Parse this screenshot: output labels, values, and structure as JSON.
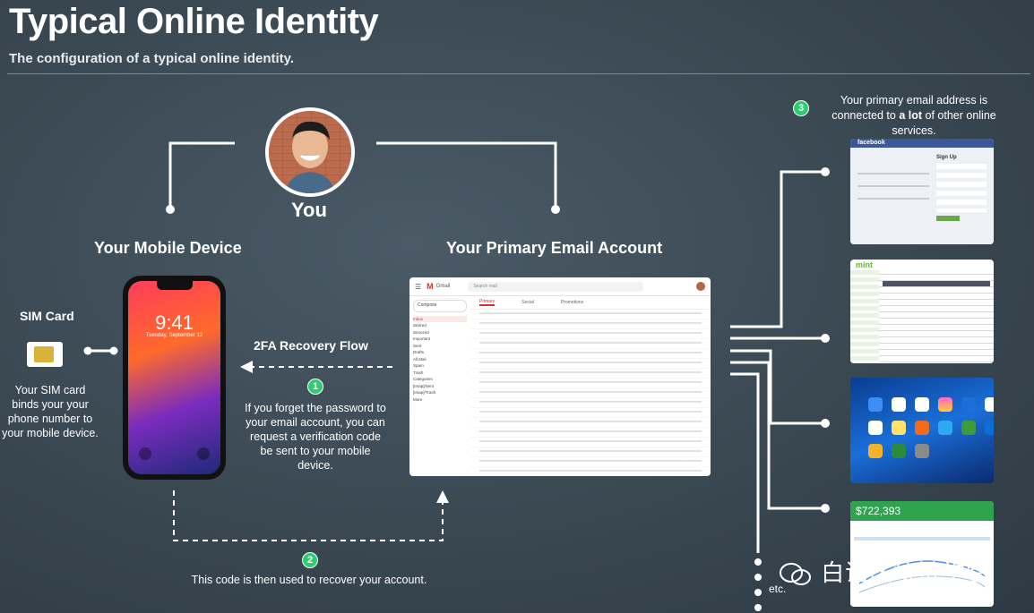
{
  "header": {
    "title": "Typical Online Identity",
    "subtitle": "The configuration of a typical online identity."
  },
  "you": {
    "label": "You"
  },
  "mobile": {
    "heading": "Your Mobile Device",
    "time": "9:41",
    "date": "Tuesday, September 12"
  },
  "email": {
    "heading": "Your Primary Email Account",
    "app_name": "Gmail",
    "search_placeholder": "Search mail",
    "compose": "Compose",
    "nav": [
      "Inbox",
      "Starred",
      "Snoozed",
      "Important",
      "Sent",
      "Drafts",
      "All Mail",
      "Spam",
      "Trash",
      "Categories",
      "[Imap]/Sent",
      "[Imap]/Trash",
      "More"
    ],
    "tabs": [
      "Primary",
      "Social",
      "Promotions"
    ]
  },
  "sim": {
    "heading": "SIM Card",
    "caption": "Your SIM card binds your your phone number to your mobile device."
  },
  "flow": {
    "title": "2FA Recovery Flow",
    "step1_num": "1",
    "step1_text": "If you forget the password to your email account, you can request a verification code be sent to your mobile device.",
    "step2_num": "2",
    "step2_text": "This code is then used to recover your account.",
    "step3_num": "3",
    "step3_text_prefix": "Your primary email address is connected to ",
    "step3_text_bold": "a lot",
    "step3_text_suffix": " of other online services."
  },
  "services": {
    "facebook": {
      "brand": "facebook",
      "signup": "Sign Up"
    },
    "mint": {
      "brand": "mint"
    },
    "finance": {
      "amount": "$722,393"
    },
    "etc": "etc."
  },
  "watermark": {
    "text": "白话区块链学堂"
  },
  "colors": {
    "background": "#3a4852",
    "step_badge": "#2ecc71",
    "facebook_blue": "#3b5998",
    "mint_green": "#6cb33f",
    "ipad_blue": "#1a6fd9",
    "finance_green": "#2ea44f"
  }
}
